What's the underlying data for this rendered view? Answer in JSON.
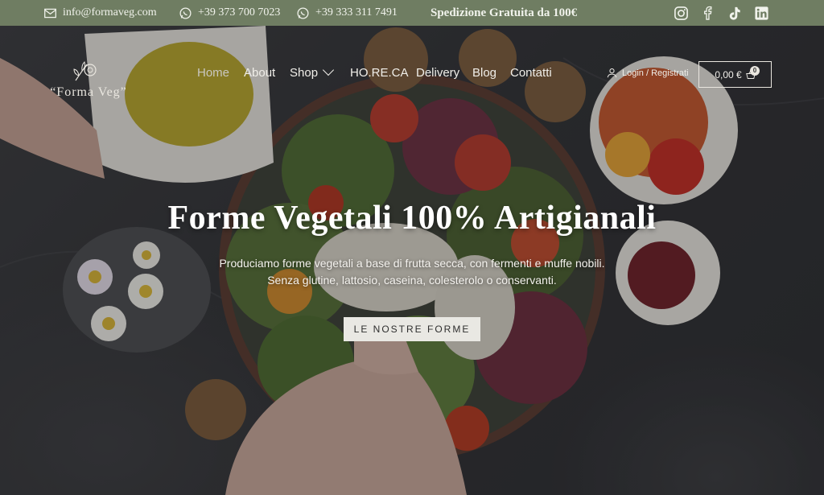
{
  "topbar": {
    "email": "info@formaveg.com",
    "phone1": "+39 373 700 7023",
    "phone2": "+39 333 311 7491",
    "shipping": "Spedizione Gratuita da 100€",
    "socials": [
      "instagram-icon",
      "facebook-icon",
      "tiktok-icon",
      "linkedin-icon"
    ]
  },
  "logo": {
    "text": "“Forma Veg”"
  },
  "nav": {
    "items": [
      {
        "label": "Home",
        "active": true
      },
      {
        "label": "About"
      },
      {
        "label": "Shop",
        "dropdown": true
      },
      {
        "label": "HO.RE.CA"
      },
      {
        "label": "Delivery"
      },
      {
        "label": "Blog"
      },
      {
        "label": "Contatti"
      }
    ],
    "login": "Login / Registrati",
    "cart_total": "0,00 €",
    "cart_count": "0"
  },
  "hero": {
    "title": "Forme Vegetali 100% Artigianali",
    "subtitle_line1": "Produciamo forme vegetali a base di frutta secca, con fermenti e muffe nobili.",
    "subtitle_line2": "Senza glutine, lattosio, caseina, colesterolo o conservanti.",
    "cta": "LE NOSTRE FORME"
  },
  "colors": {
    "topbar": "#6f7d62",
    "cta_bg": "#e9e8e3"
  }
}
